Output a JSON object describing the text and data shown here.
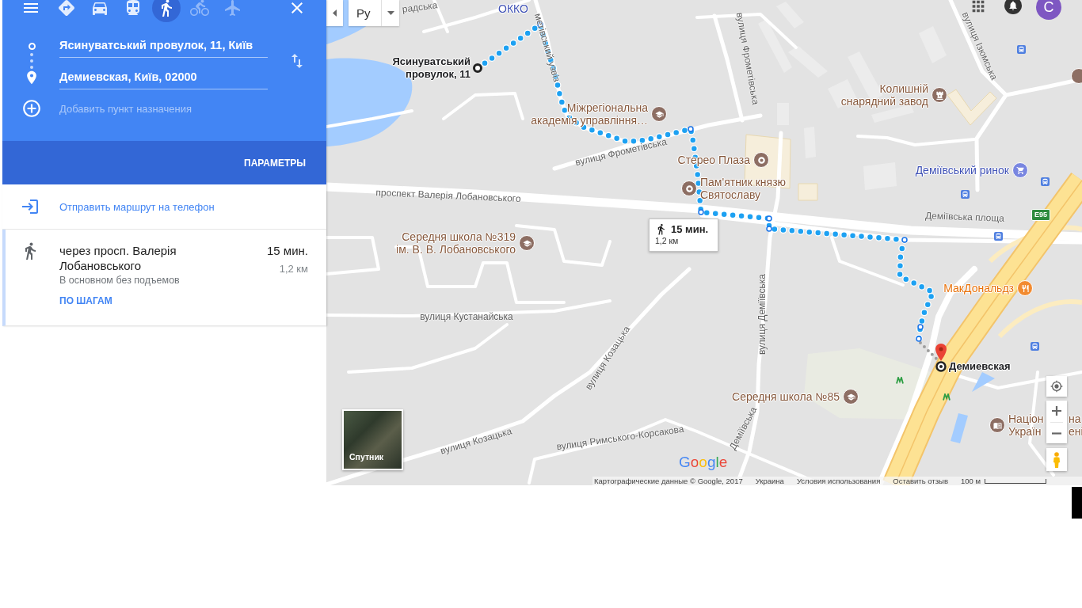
{
  "travel_modes": [
    {
      "kind": "best",
      "selected": false,
      "disabled": false
    },
    {
      "kind": "car",
      "selected": false,
      "disabled": false
    },
    {
      "kind": "transit",
      "selected": false,
      "disabled": false
    },
    {
      "kind": "walk",
      "selected": true,
      "disabled": false
    },
    {
      "kind": "bicycle",
      "selected": false,
      "disabled": true
    },
    {
      "kind": "flight",
      "selected": false,
      "disabled": true
    }
  ],
  "route_form": {
    "origin": "Ясинуватський провулок, 11, Київ",
    "destination": "Демиевская, Київ, 02000",
    "add_stop": {
      "placeholder": "Добавить пункт назначения"
    }
  },
  "options_button": "ПАРАМЕТРЫ",
  "send_to_phone": "Отправить маршрут на телефон",
  "routes": [
    {
      "kind": "walk",
      "via": "через просп. Валерія Лобановського",
      "duration": "15 мин.",
      "distance": "1,2 км",
      "note": "В основном без подъемов",
      "details_link": "ПО ШАГАМ",
      "selected": true
    }
  ],
  "map": {
    "language": "Ру",
    "account_initial": "С",
    "labels": [
      {
        "kind": "road",
        "text": "радська"
      },
      {
        "kind": "fuel",
        "text": "ОККО"
      },
      {
        "kind": "road",
        "text": "метівський узвіз"
      },
      {
        "kind": "pin",
        "text": "Ясинуватський\nпровулок, 11"
      },
      {
        "kind": "road",
        "text": "вулиця Фрометівська"
      },
      {
        "kind": "landmark",
        "text": "Колишній\nснарядний завод"
      },
      {
        "kind": "road",
        "text": "вулиця Ізюмська"
      },
      {
        "kind": "education",
        "text": "Міжрегіональна\nакадемія управління…"
      },
      {
        "kind": "road",
        "text": "вулиця Фрометівська"
      },
      {
        "kind": "place",
        "text": "Стерео Плаза"
      },
      {
        "kind": "shopping",
        "text": "Деміївський ринок"
      },
      {
        "kind": "place",
        "text": "Пам'ятник князю\nСвятославу"
      },
      {
        "kind": "road",
        "text": "проспект Валерія Лобановського"
      },
      {
        "kind": "road",
        "text": "Деміївська площа"
      },
      {
        "kind": "shield",
        "text": "E95"
      },
      {
        "kind": "education",
        "text": "Середня школа №319\nім. В. В. Лобановського"
      },
      {
        "kind": "food",
        "text": "МакДональдз"
      },
      {
        "kind": "road",
        "text": "вулиця Кустанайська"
      },
      {
        "kind": "road",
        "text": "вулиця Деміївська"
      },
      {
        "kind": "road",
        "text": "вулиця Козацька"
      },
      {
        "kind": "pin",
        "text": "Демиевская"
      },
      {
        "kind": "education",
        "text": "Середня школа №85"
      },
      {
        "kind": "university",
        "text": "Націон\nУкраїн"
      },
      {
        "kind": "partial",
        "text": "на\nені"
      },
      {
        "kind": "road",
        "text": "вулиця Козацька"
      },
      {
        "kind": "road",
        "text": "вулиця Римського-Корсакова"
      },
      {
        "kind": "road",
        "text": "Деміївська"
      }
    ],
    "route_callout": {
      "kind": "walk",
      "duration": "15 мин.",
      "distance": "1,2 км"
    },
    "satellite_button": "Спутник",
    "logo": "Google",
    "attribution": [
      "Картографические данные © Google, 2017",
      "Украина",
      "Условия использования",
      "Оставить отзыв"
    ],
    "scale": "100 м"
  }
}
